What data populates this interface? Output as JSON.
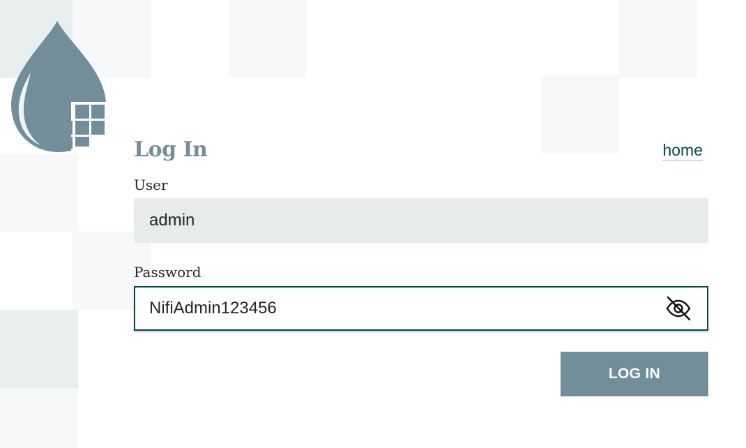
{
  "colors": {
    "brand": "#728e9b",
    "accent": "#004849",
    "input_bg": "#e8ebeb",
    "tile_light": "#f6f8f9",
    "tile_dark": "#e9eeee"
  },
  "logo": {
    "icon": "nifi-drop-logo-icon"
  },
  "header": {
    "title": "Log In",
    "home_link": "home"
  },
  "form": {
    "user_label": "User",
    "user_value": "admin",
    "password_label": "Password",
    "password_value": "NifiAdmin123456",
    "toggle_icon": "eye-slash-icon",
    "submit_label": "LOG IN"
  }
}
